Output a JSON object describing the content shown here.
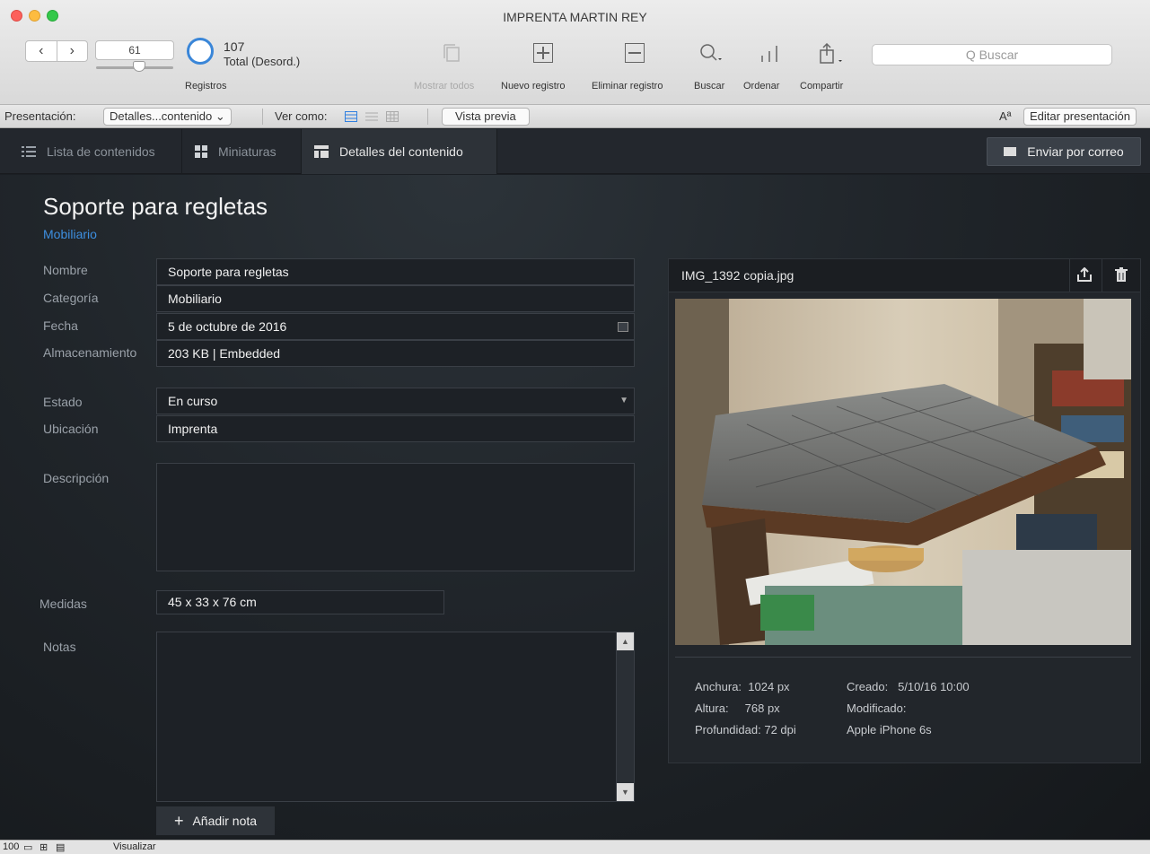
{
  "window": {
    "title": "IMPRENTA MARTIN REY"
  },
  "toolbar": {
    "record_number": "61",
    "total_count": "107",
    "total_label": "Total (Desord.)",
    "records_label": "Registros",
    "show_all": "Mostrar todos",
    "new_record": "Nuevo registro",
    "delete_record": "Eliminar registro",
    "search": "Buscar",
    "sort": "Ordenar",
    "share": "Compartir",
    "search_placeholder": "Q Buscar"
  },
  "layout_bar": {
    "presentation_label": "Presentación:",
    "presentation_value": "Detalles...contenido",
    "view_as_label": "Ver como:",
    "preview_button": "Vista previa",
    "font_icon_label": "Aª",
    "edit_layout": "Editar presentación"
  },
  "tabs": [
    {
      "label": "Lista de contenidos",
      "icon": "list-icon",
      "active": false
    },
    {
      "label": "Miniaturas",
      "icon": "grid-icon",
      "active": false
    },
    {
      "label": "Detalles del contenido",
      "icon": "detail-icon",
      "active": true
    }
  ],
  "mail_button": "Enviar por correo",
  "record": {
    "title": "Soporte para regletas",
    "category_link": "Mobiliario"
  },
  "fields": {
    "name_label": "Nombre",
    "name_value": "Soporte para regletas",
    "category_label": "Categoría",
    "category_value": "Mobiliario",
    "date_label": "Fecha",
    "date_value": "5 de octubre de 2016",
    "storage_label": "Almacenamiento",
    "storage_value": "203 KB | Embedded",
    "status_label": "Estado",
    "status_value": "En curso",
    "location_label": "Ubicación",
    "location_value": "Imprenta",
    "description_label": "Descripción",
    "description_value": "",
    "measures_label": "Medidas",
    "measures_value": "45 x 33 x 76 cm",
    "notes_label": "Notas",
    "notes_value": ""
  },
  "add_note": "Añadir nota",
  "image": {
    "filename": "IMG_1392 copia.jpg",
    "width_label": "Anchura:",
    "width_value": "1024 px",
    "height_label": "Altura:",
    "height_value": "768 px",
    "depth_label": "Profundidad:",
    "depth_value": "72 dpi",
    "created_label": "Creado:",
    "created_value": "5/10/16 10:00",
    "modified_label": "Modificado:",
    "device": "Apple iPhone 6s"
  },
  "statusbar": {
    "zoom": "100",
    "mode": "Visualizar"
  },
  "colors": {
    "accent": "#3d8fe0",
    "dark_bg": "#1b1f24",
    "toolbar_bg": "#e3e3e3"
  }
}
